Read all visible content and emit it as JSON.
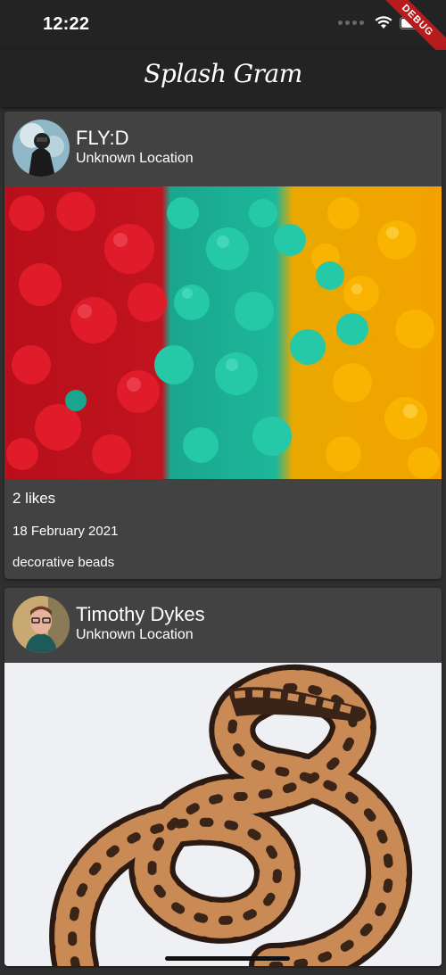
{
  "status": {
    "time": "12:22",
    "debug_label": "DEBUG"
  },
  "app": {
    "title": "Splash Gram"
  },
  "posts": [
    {
      "user": "FLY:D",
      "location": "Unknown Location",
      "likes": "2 likes",
      "date": "18 February 2021",
      "description": "decorative beads"
    },
    {
      "user": "Timothy Dykes",
      "location": "Unknown Location"
    }
  ],
  "icons": [
    "signal-dots-icon",
    "wifi-icon",
    "battery-icon"
  ]
}
